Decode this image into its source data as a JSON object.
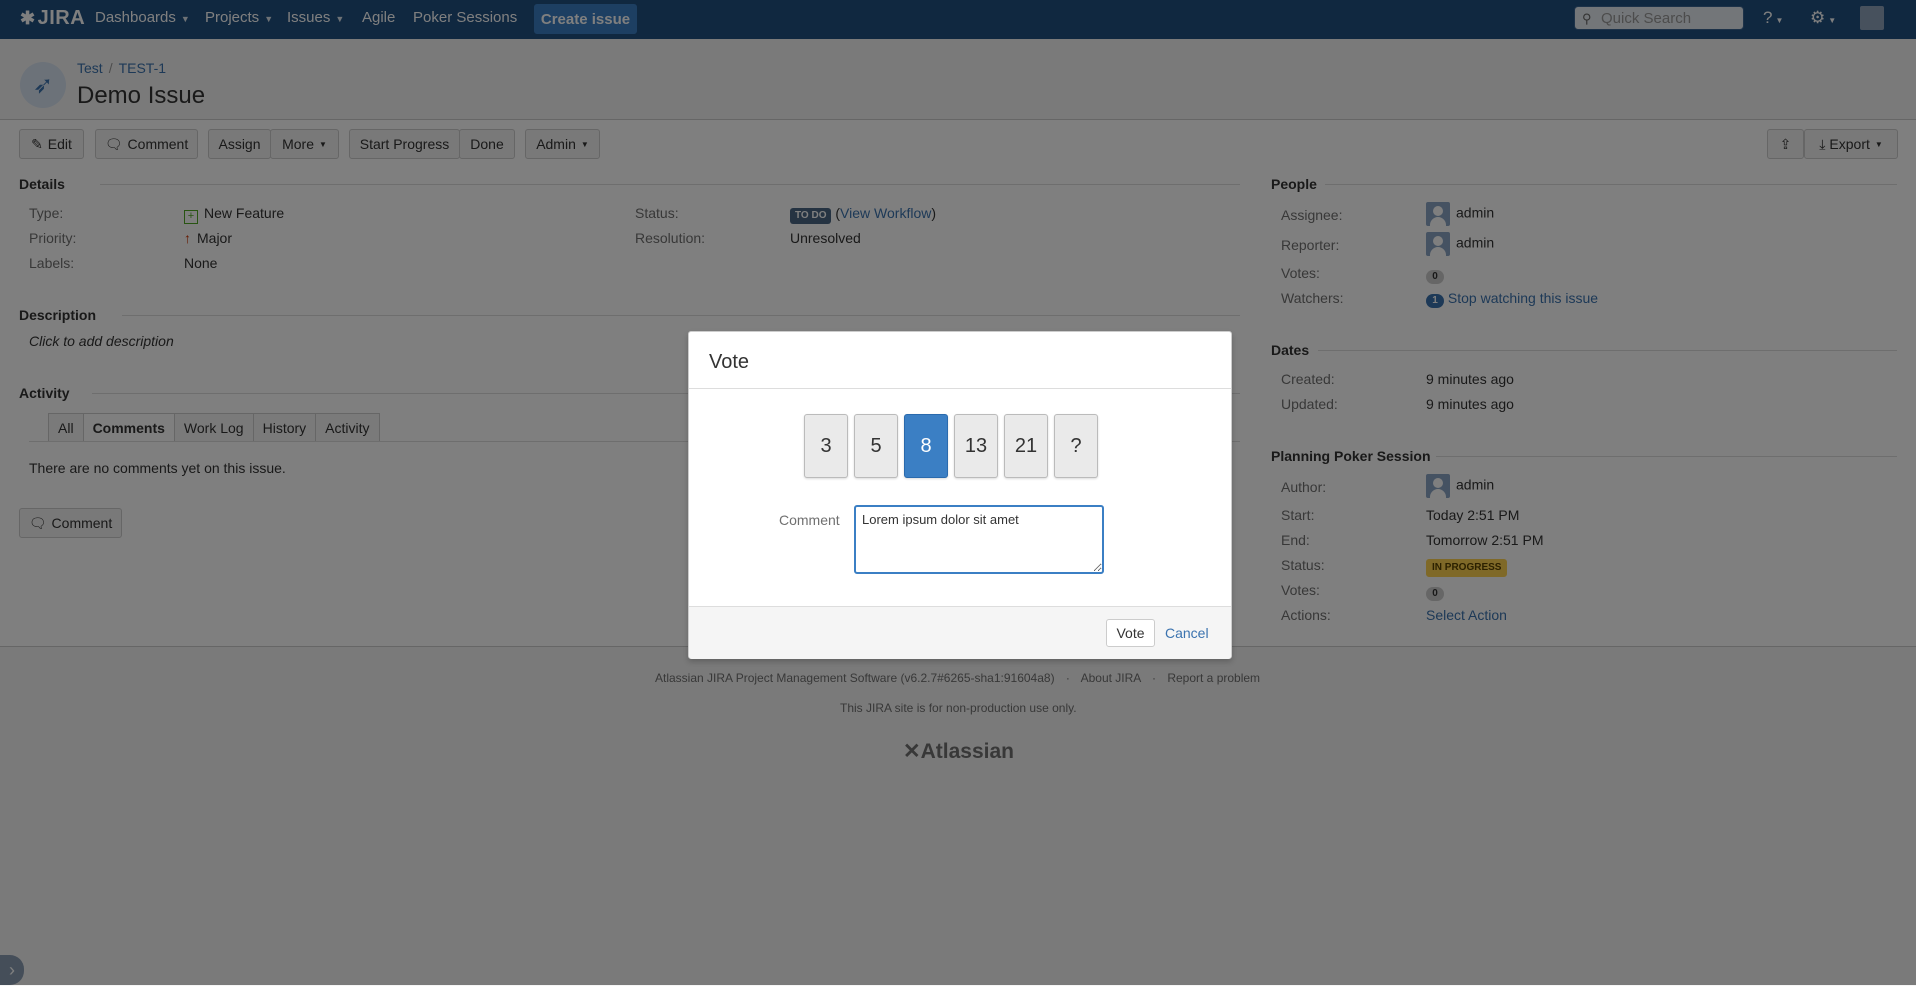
{
  "header": {
    "logo": "JIRA",
    "nav": [
      "Dashboards",
      "Projects",
      "Issues",
      "Agile",
      "Poker Sessions"
    ],
    "create_label": "Create issue",
    "search_placeholder": "Quick Search"
  },
  "issue": {
    "project": "Test",
    "key": "TEST-1",
    "title": "Demo Issue"
  },
  "toolbar": {
    "edit": "Edit",
    "comment": "Comment",
    "assign": "Assign",
    "more": "More",
    "start_progress": "Start Progress",
    "done": "Done",
    "admin": "Admin",
    "export": "Export"
  },
  "details": {
    "heading": "Details",
    "type_label": "Type:",
    "type_value": "New Feature",
    "priority_label": "Priority:",
    "priority_value": "Major",
    "labels_label": "Labels:",
    "labels_value": "None",
    "status_label": "Status:",
    "status_value": "TO DO",
    "view_workflow": "View Workflow",
    "resolution_label": "Resolution:",
    "resolution_value": "Unresolved"
  },
  "description": {
    "heading": "Description",
    "placeholder": "Click to add description"
  },
  "activity": {
    "heading": "Activity",
    "tabs": [
      "All",
      "Comments",
      "Work Log",
      "History",
      "Activity"
    ],
    "empty": "There are no comments yet on this issue.",
    "comment_button": "Comment"
  },
  "people": {
    "heading": "People",
    "assignee_label": "Assignee:",
    "assignee": "admin",
    "reporter_label": "Reporter:",
    "reporter": "admin",
    "votes_label": "Votes:",
    "votes": "0",
    "watchers_label": "Watchers:",
    "watchers": "1",
    "stop_watching": "Stop watching this issue"
  },
  "dates": {
    "heading": "Dates",
    "created_label": "Created:",
    "created": "9 minutes ago",
    "updated_label": "Updated:",
    "updated": "9 minutes ago"
  },
  "poker": {
    "heading": "Planning Poker Session",
    "author_label": "Author:",
    "author": "admin",
    "start_label": "Start:",
    "start": "Today 2:51 PM",
    "end_label": "End:",
    "end": "Tomorrow 2:51 PM",
    "status_label": "Status:",
    "status": "IN PROGRESS",
    "votes_label": "Votes:",
    "votes": "0",
    "actions_label": "Actions:",
    "actions": "Select Action"
  },
  "footer": {
    "software": "Atlassian JIRA Project Management Software (v6.2.7#6265-sha1:91604a8)",
    "about": "About JIRA",
    "report": "Report a problem",
    "nonprod": "This JIRA site is for non-production use only.",
    "atlassian": "Atlassian"
  },
  "vote_dialog": {
    "title": "Vote",
    "cards": [
      "3",
      "5",
      "8",
      "13",
      "21",
      "?"
    ],
    "selected": "8",
    "comment_label": "Comment",
    "comment_value": "Lorem ipsum dolor sit amet",
    "vote_button": "Vote",
    "cancel": "Cancel"
  },
  "colors": {
    "header_bg": "#205081",
    "accent": "#3b7fc4",
    "link": "#3b73af"
  }
}
